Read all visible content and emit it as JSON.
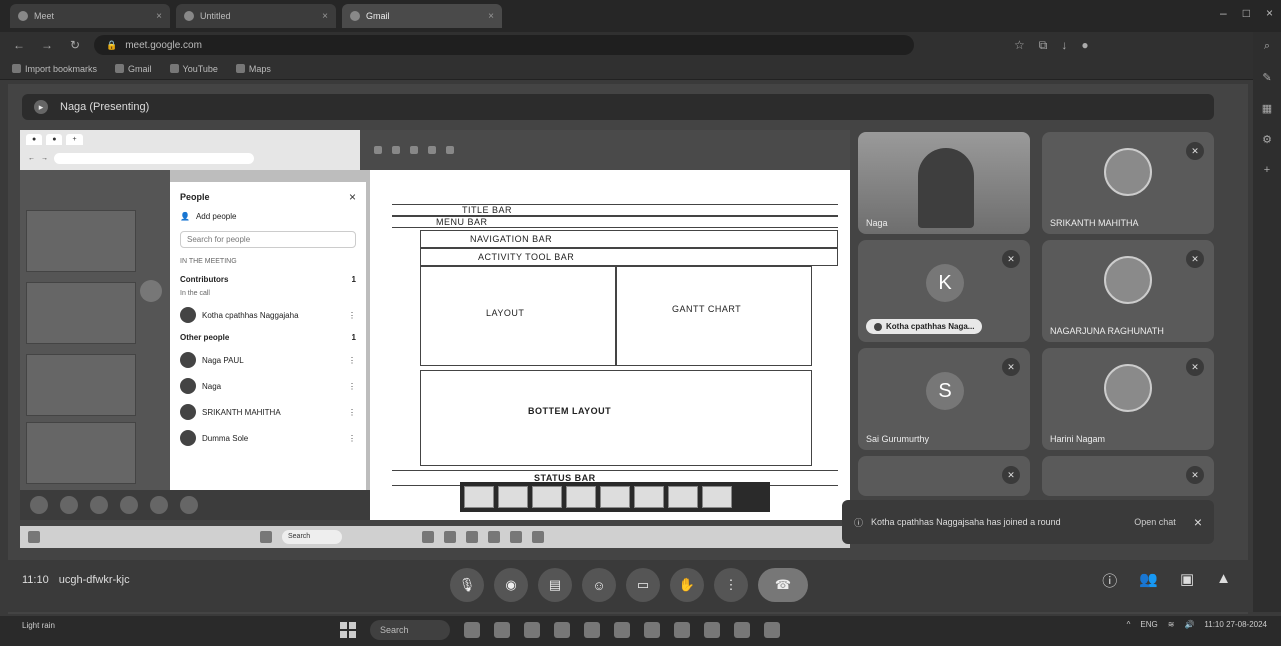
{
  "browser": {
    "tabs": [
      "Meet",
      "Untitled",
      "Gmail"
    ],
    "url": "meet.google.com"
  },
  "bookmarks": [
    "Import bookmarks",
    "Gmail",
    "YouTube",
    "Maps"
  ],
  "meet": {
    "presenting_label": "Naga (Presenting)",
    "meeting_time": "11:10",
    "meeting_code": "ucgh-dfwkr-kjc",
    "notification": {
      "text": "Kotha cpathhas Naggajsaha has joined a round",
      "action": "Open chat"
    }
  },
  "shared_screen": {
    "people_panel": {
      "title": "People",
      "add_people": "Add people",
      "search_placeholder": "Search for people",
      "in_meeting": "IN THE MEETING",
      "contributors": "Contributors",
      "contributors_count": "1",
      "others": "Other people",
      "others_count": "1",
      "participants": [
        {
          "name": "Kotha cpathhas Naggajaha"
        },
        {
          "name": "Naga PAUL"
        },
        {
          "name": "Naga"
        },
        {
          "name": "SRIKANTH MAHITHA"
        },
        {
          "name": "Dumma Sole"
        }
      ],
      "in_meeting_label": "In the call"
    },
    "wireframe": {
      "title_bar": "TITLE BAR",
      "menu_bar": "MENU BAR",
      "navigation_bar": "NAVIGATION BAR",
      "activity_tool_bar": "ACTIVITY TOOL BAR",
      "layout": "LAYOUT",
      "gantt_chart": "GANTT CHART",
      "bottom_layout": "BOTTEM LAYOUT",
      "status_bar": "STATUS BAR"
    },
    "taskbar_search": "Search"
  },
  "tiles": [
    {
      "name": "Naga",
      "type": "video"
    },
    {
      "name": "SRIKANTH MAHITHA",
      "type": "photo"
    },
    {
      "name": "Kotha cpathhas Naga...",
      "type": "letter",
      "letter": "K"
    },
    {
      "name": "NAGARJUNA RAGHUNATH",
      "type": "photo"
    },
    {
      "name": "Sai Gurumurthy",
      "type": "letter",
      "letter": "S"
    },
    {
      "name": "Harini Nagam",
      "type": "photo"
    }
  ],
  "taskbar": {
    "search": "Search",
    "weather": "Light rain",
    "lang": "ENG",
    "time": "11:10",
    "date": "27-08-2024"
  }
}
